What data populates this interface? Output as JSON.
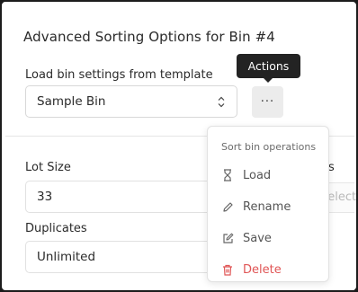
{
  "dialog": {
    "title": "Advanced Sorting Options for Bin #4",
    "template_label": "Load bin settings from template",
    "template_value": "Sample Bin",
    "actions_button_label": "···",
    "actions_tooltip": "Actions"
  },
  "fields": {
    "lot_size_label": "Lot Size",
    "lot_size_value": "33",
    "duplicates_label": "Duplicates",
    "duplicates_value": "Unlimited",
    "partial_label": "s",
    "partial_placeholder": "Select"
  },
  "menu": {
    "header": "Sort bin operations",
    "items": [
      {
        "label": "Load",
        "icon": "hourglass-icon"
      },
      {
        "label": "Rename",
        "icon": "pencil-icon"
      },
      {
        "label": "Save",
        "icon": "edit-square-icon"
      },
      {
        "label": "Delete",
        "icon": "trash-icon",
        "danger": true
      }
    ]
  },
  "colors": {
    "danger": "#e05656",
    "tooltip_bg": "#232323",
    "button_bg": "#ececec"
  }
}
